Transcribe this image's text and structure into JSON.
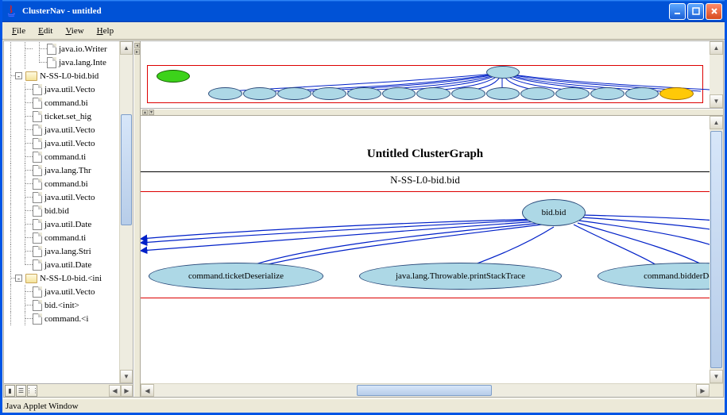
{
  "window": {
    "title": "ClusterNav - untitled"
  },
  "menus": {
    "file": "File",
    "edit": "Edit",
    "view": "View",
    "help": "Help"
  },
  "tree": {
    "item0": "java.io.Writer",
    "item1": "java.lang.Inte",
    "folder1": "N-SS-L0-bid.bid",
    "i1_0": "java.util.Vecto",
    "i1_1": "command.bi",
    "i1_2": "ticket.set_hig",
    "i1_3": "java.util.Vecto",
    "i1_4": "java.util.Vecto",
    "i1_5": "command.ti",
    "i1_6": "java.lang.Thr",
    "i1_7": "command.bi",
    "i1_8": "java.util.Vecto",
    "i1_9": "bid.bid",
    "i1_10": "java.util.Date",
    "i1_11": "command.ti",
    "i1_12": "java.lang.Stri",
    "i1_13": "java.util.Date",
    "folder2": "N-SS-L0-bid.<ini",
    "i2_0": "java.util.Vecto",
    "i2_1": "bid.<init>",
    "i2_2": "command.<i"
  },
  "graph": {
    "title": "Untitled ClusterGraph",
    "subtitle": "N-SS-L0-bid.bid",
    "root": "bid.bid",
    "child1": "command.ticketDeserialize",
    "child2": "java.lang.Throwable.printStackTrace",
    "child3": "command.bidderDeserialize"
  },
  "status": "Java Applet Window"
}
